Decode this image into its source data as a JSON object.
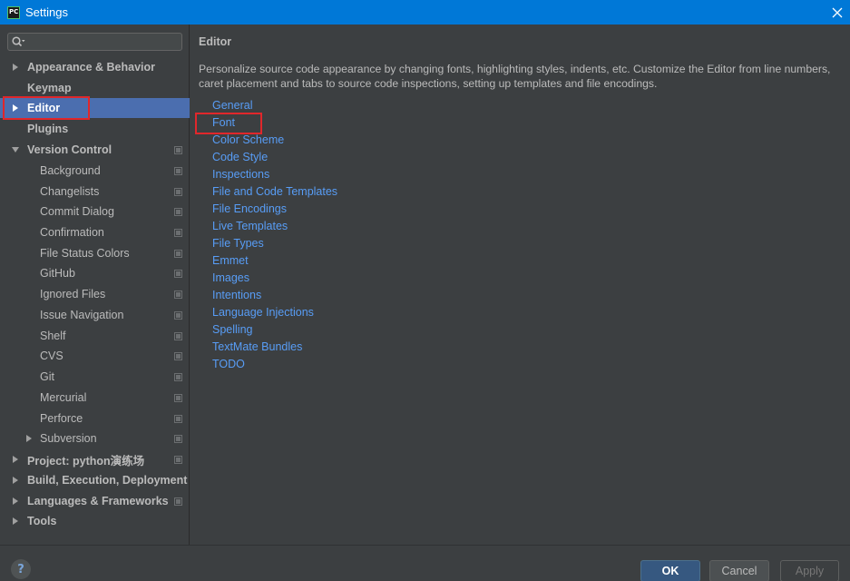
{
  "window": {
    "title": "Settings",
    "app_icon_text": "PC"
  },
  "search": {
    "placeholder": ""
  },
  "sidebar": {
    "items": [
      {
        "label": "Appearance & Behavior"
      },
      {
        "label": "Keymap"
      },
      {
        "label": "Editor"
      },
      {
        "label": "Plugins"
      },
      {
        "label": "Version Control"
      },
      {
        "label": "Background"
      },
      {
        "label": "Changelists"
      },
      {
        "label": "Commit Dialog"
      },
      {
        "label": "Confirmation"
      },
      {
        "label": "File Status Colors"
      },
      {
        "label": "GitHub"
      },
      {
        "label": "Ignored Files"
      },
      {
        "label": "Issue Navigation"
      },
      {
        "label": "Shelf"
      },
      {
        "label": "CVS"
      },
      {
        "label": "Git"
      },
      {
        "label": "Mercurial"
      },
      {
        "label": "Perforce"
      },
      {
        "label": "Subversion"
      },
      {
        "label": "Project: python演练场"
      },
      {
        "label": "Build, Execution, Deployment"
      },
      {
        "label": "Languages & Frameworks"
      },
      {
        "label": "Tools"
      }
    ]
  },
  "content": {
    "title": "Editor",
    "description": "Personalize source code appearance by changing fonts, highlighting styles, indents, etc. Customize the Editor from line numbers, caret placement and tabs to source code inspections, setting up templates and file encodings.",
    "links": [
      "General",
      "Font",
      "Color Scheme",
      "Code Style",
      "Inspections",
      "File and Code Templates",
      "File Encodings",
      "Live Templates",
      "File Types",
      "Emmet",
      "Images",
      "Intentions",
      "Language Injections",
      "Spelling",
      "TextMate Bundles",
      "TODO"
    ]
  },
  "footer": {
    "help": "?",
    "ok": "OK",
    "cancel": "Cancel",
    "apply": "Apply"
  },
  "colors": {
    "accent": "#4b6eaf",
    "link": "#589df6",
    "titlebar": "#0078d7",
    "highlight": "#e0272b"
  }
}
